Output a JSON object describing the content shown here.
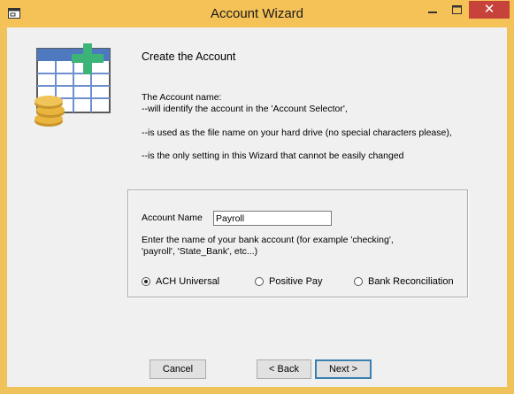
{
  "window": {
    "title": "Account Wizard",
    "minimize_glyph": "–",
    "maximize_glyph": "☐",
    "close_glyph": "✕"
  },
  "page": {
    "heading": "Create the Account",
    "description": [
      "The Account name:",
      "--will identify the account in the 'Account Selector',",
      "--is used as the file name on your hard drive (no special characters please),",
      "--is the only setting in this Wizard that cannot be easily changed"
    ]
  },
  "form": {
    "account_name_label": "Account Name",
    "account_name_value": "Payroll",
    "hint": "Enter the name of your bank account (for example 'checking', 'payroll', 'State_Bank', etc...)",
    "options": [
      {
        "label": "ACH Universal",
        "selected": true
      },
      {
        "label": "Positive Pay",
        "selected": false
      },
      {
        "label": "Bank Reconciliation",
        "selected": false
      }
    ]
  },
  "buttons": {
    "cancel": "Cancel",
    "back": "< Back",
    "next": "Next >"
  },
  "colors": {
    "titlebar": "#f5c258",
    "close_button": "#c7423b",
    "client": "#f0f0f0",
    "logo_blue": "#4f79bf",
    "logo_green": "#3cb478",
    "coin_gold": "#e9b53e"
  },
  "icons": [
    "wizard-window-icon",
    "account-ledger-logo"
  ]
}
